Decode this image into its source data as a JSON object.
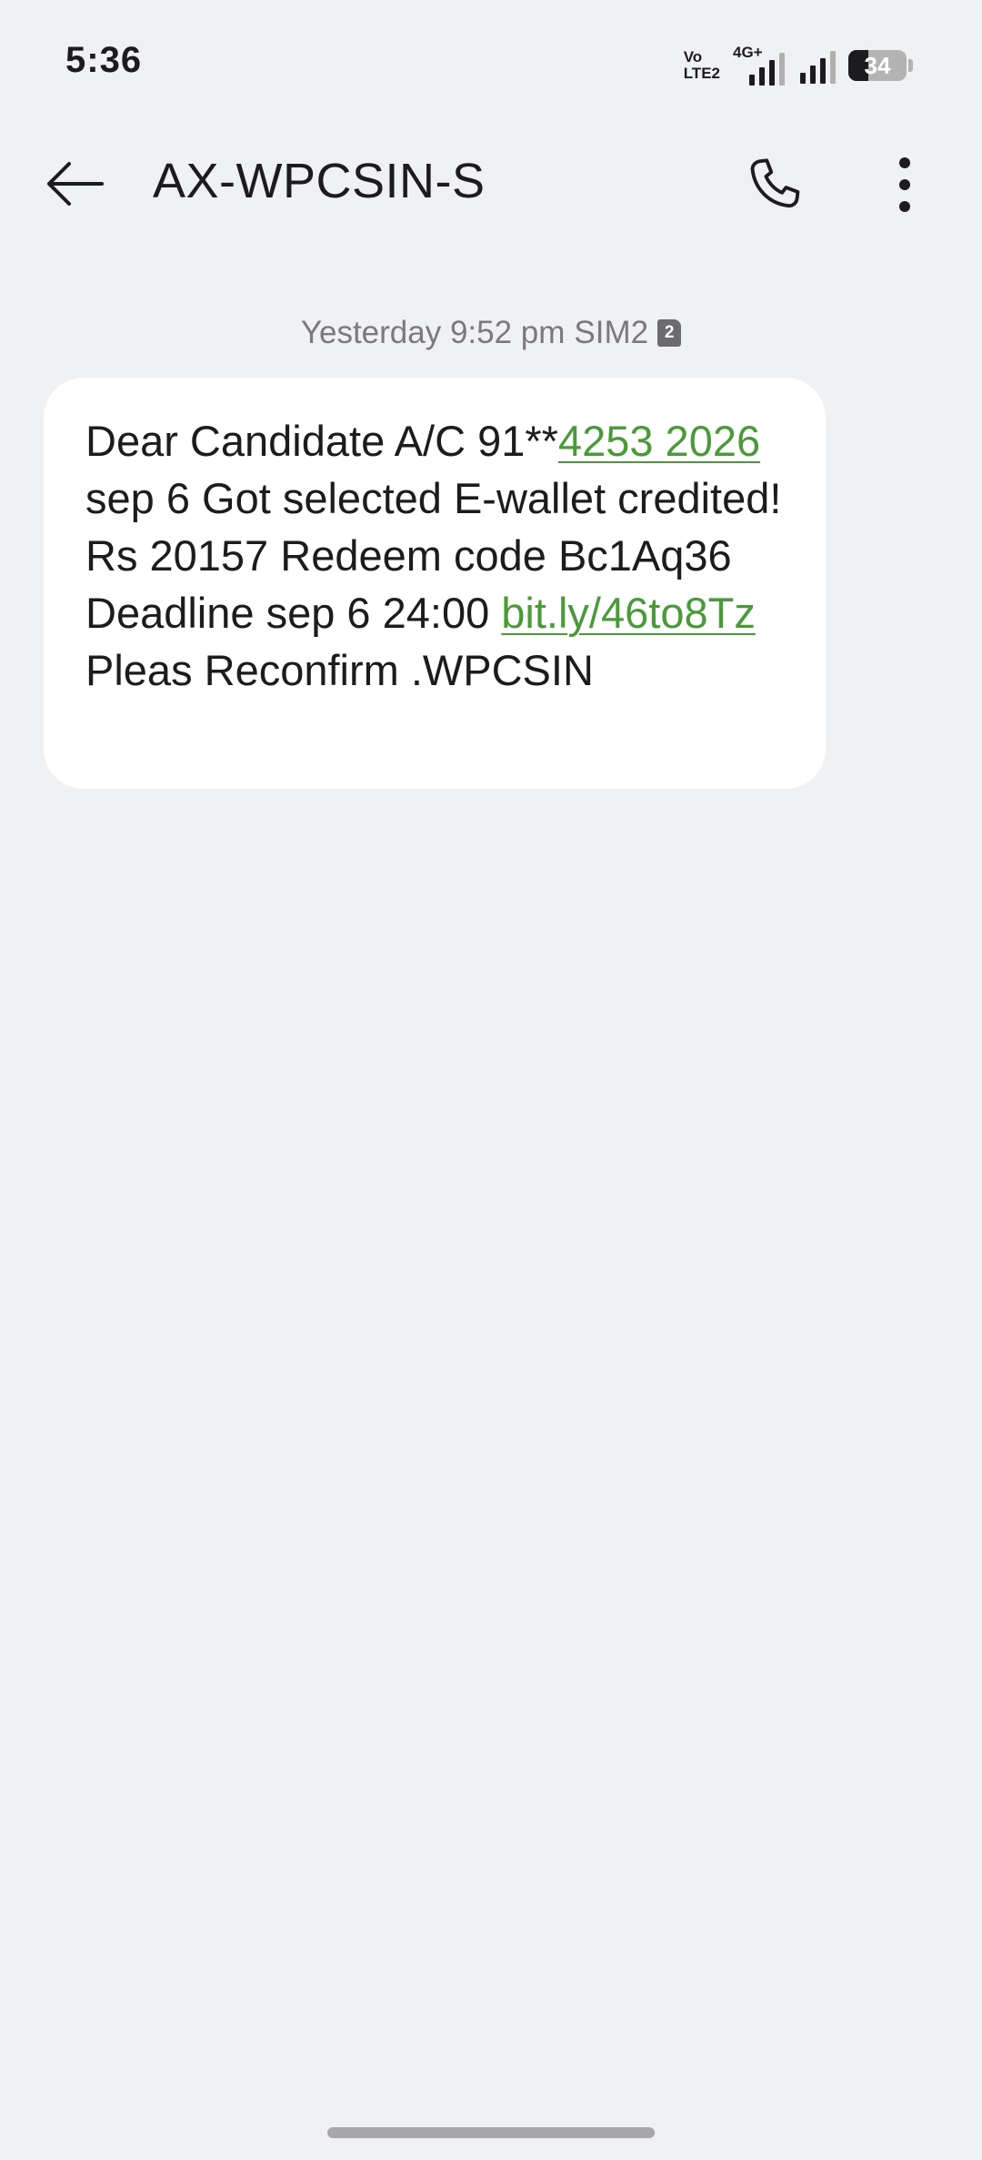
{
  "status_bar": {
    "time": "5:36",
    "volte_top": "Vo",
    "volte_bottom": "LTE2",
    "network_type": "4G+",
    "battery_percent": "34"
  },
  "app_bar": {
    "title": "AX-WPCSIN-S",
    "back_icon": "arrow-left-icon",
    "call_icon": "phone-icon",
    "more_icon": "more-vert-icon"
  },
  "message": {
    "timestamp": "Yesterday 9:52 pm",
    "sim_label": "SIM2",
    "sim_badge": "2",
    "parts": {
      "p1": "Dear Candidate A/C 91**",
      "link_number": "4253 2026",
      "p2": " sep 6 Got selected E-wallet credited! Rs 20157 Redeem code Bc1Aq36 Deadline sep 6 24:00 ",
      "link_url": "bit.ly/46to8Tz",
      "p3": " Pleas Reconfirm .WPCSIN"
    }
  },
  "colors": {
    "background": "#f0f1f3",
    "bubble": "#ffffff",
    "link": "#4a9a3a",
    "text": "#1c1c1e",
    "timestamp": "#7a7a7e"
  }
}
